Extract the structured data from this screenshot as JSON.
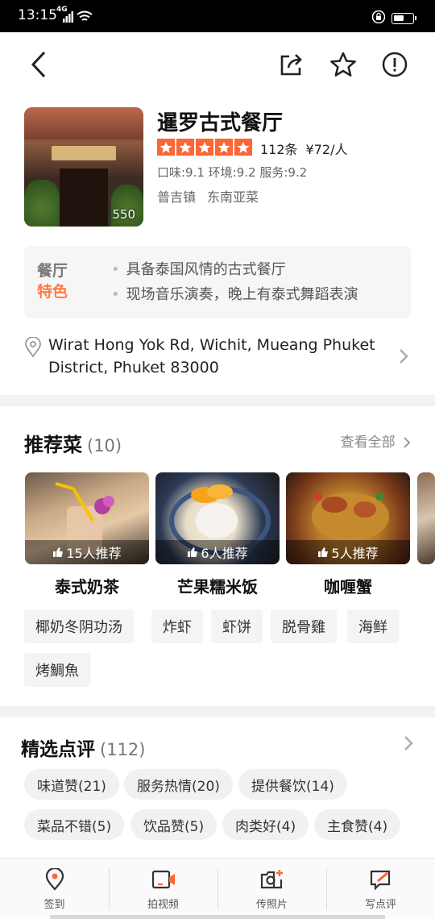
{
  "status_bar": {
    "time": "13:15",
    "signal": "4G"
  },
  "restaurant": {
    "name": "暹罗古式餐厅",
    "photo_count": "550",
    "rating": 5,
    "reviews_count": "112条",
    "price": "¥72/人",
    "scores": "口味:9.1 环境:9.2 服务:9.2",
    "area": "普吉镇",
    "cuisine": "东南亚菜"
  },
  "feature": {
    "badge_line1": "餐厅",
    "badge_line2": "特色",
    "items": [
      "具备泰国风情的古式餐厅",
      "现场音乐演奏，晚上有泰式舞蹈表演"
    ]
  },
  "address": "Wirat Hong Yok Rd, Wichit, Mueang Phuket District, Phuket 83000",
  "recommended": {
    "title": "推荐菜",
    "count": "(10)",
    "see_all": "查看全部",
    "dishes": [
      {
        "name": "泰式奶茶",
        "recommend": "15人推荐"
      },
      {
        "name": "芒果糯米饭",
        "recommend": "6人推荐"
      },
      {
        "name": "咖喱蟹",
        "recommend": "5人推荐"
      }
    ],
    "chips": [
      "椰奶冬阴功汤",
      "炸虾",
      "虾饼",
      "脱骨雞",
      "海鲜",
      "烤鯛魚"
    ]
  },
  "reviews": {
    "title": "精选点评",
    "count": "(112)",
    "chips": [
      "味道赞(21)",
      "服务热情(20)",
      "提供餐饮(14)",
      "菜品不错(5)",
      "饮品赞(5)",
      "肉类好(4)",
      "主食赞(4)"
    ]
  },
  "bottom_bar": [
    {
      "label": "签到",
      "icon": "location-pin-icon"
    },
    {
      "label": "拍视频",
      "icon": "video-camera-icon"
    },
    {
      "label": "传照片",
      "icon": "photo-camera-icon"
    },
    {
      "label": "写点评",
      "icon": "write-review-icon"
    }
  ],
  "colors": {
    "accent": "#ff6633",
    "orange_text": "#ff7a45"
  }
}
